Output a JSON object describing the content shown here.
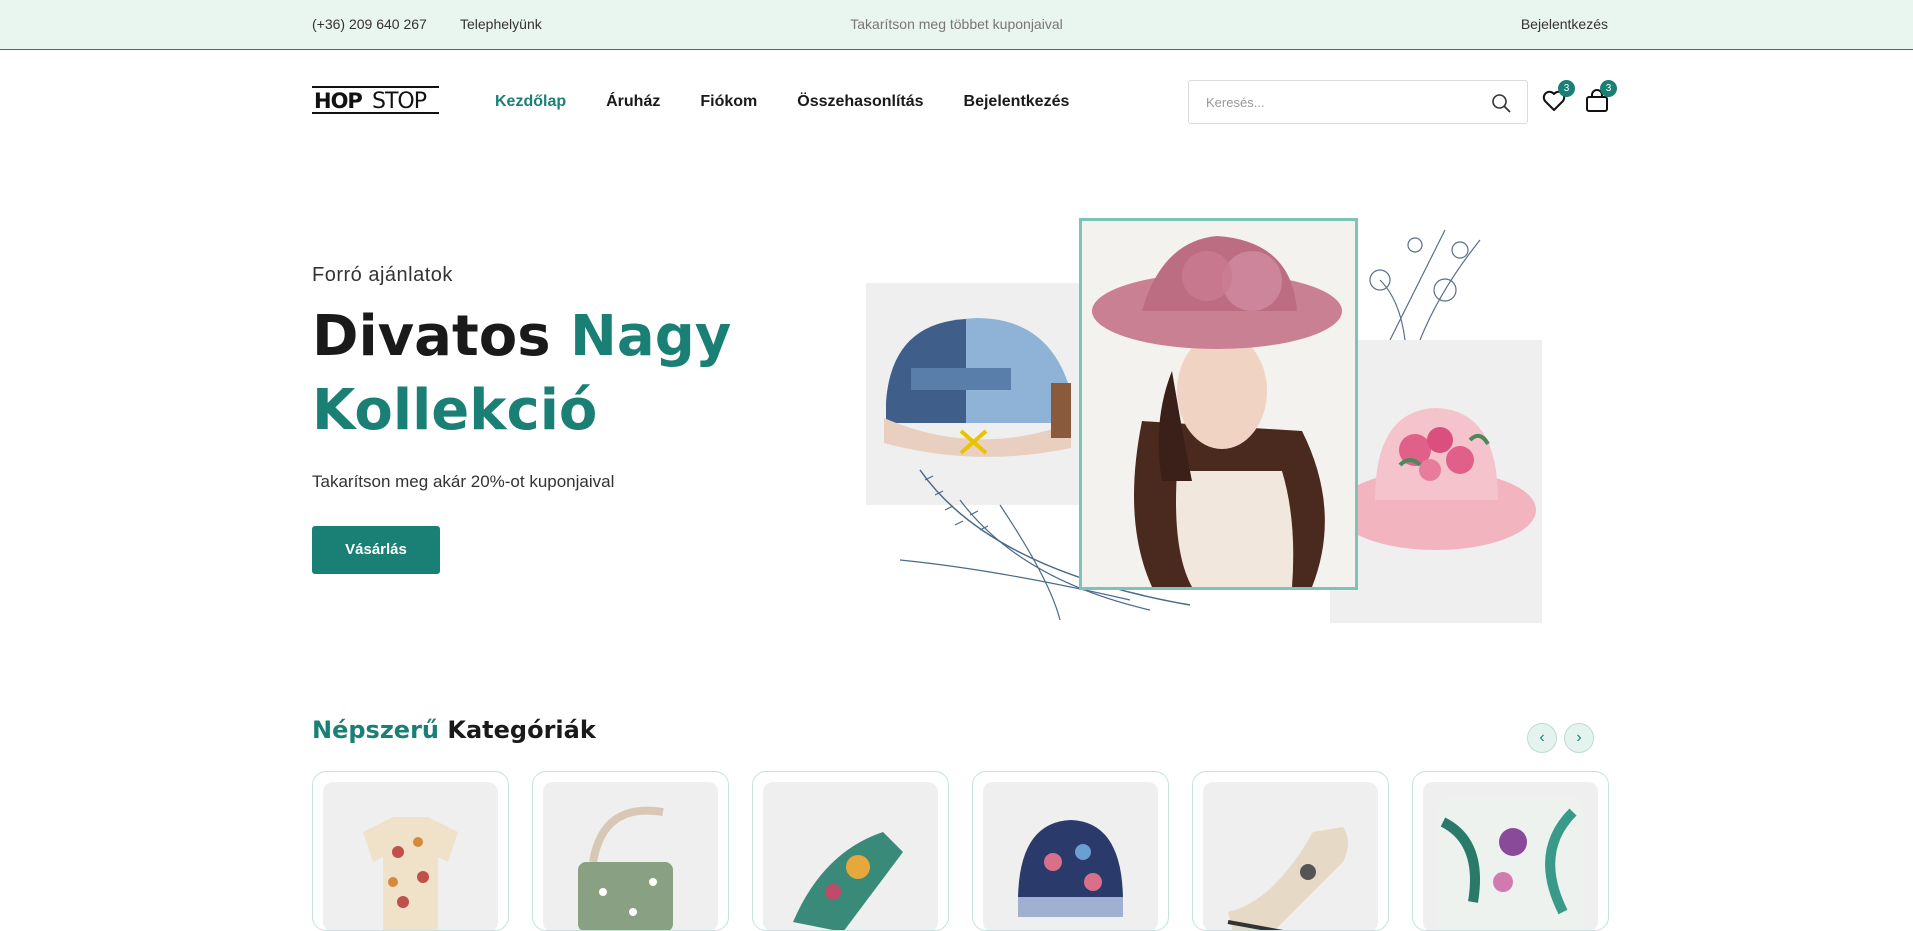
{
  "topbar": {
    "phone": "(+36) 209 640 267",
    "locations": "Telephelyünk",
    "promo": "Takarítson meg többet kuponjaival",
    "login": "Bejelentkezés"
  },
  "header": {
    "logo_part1": "HOP",
    "logo_part2": "STOP",
    "nav": [
      "Kezdőlap",
      "Áruház",
      "Fiókom",
      "Összehasonlítás",
      "Bejelentkezés"
    ],
    "search_placeholder": "Keresés...",
    "wishlist_count": "3",
    "cart_count": "3"
  },
  "hero": {
    "kicker": "Forró ajánlatok",
    "title_plain": "Divatos",
    "title_accent1": "Nagy",
    "title_accent2": "Kollekció",
    "subtitle": "Takarítson meg akár 20%-ot kuponjaival",
    "button": "Vásárlás"
  },
  "categories": {
    "title_accent": "Népszerű",
    "title_rest": "Kategóriák",
    "prev_icon": "chevron-left-icon",
    "next_icon": "chevron-right-icon",
    "items": [
      "shirt",
      "bag",
      "sandal",
      "beanie",
      "sneaker",
      "pillow"
    ]
  },
  "colors": {
    "accent": "#1a7f74",
    "topbar_bg": "#e9f5ef"
  }
}
